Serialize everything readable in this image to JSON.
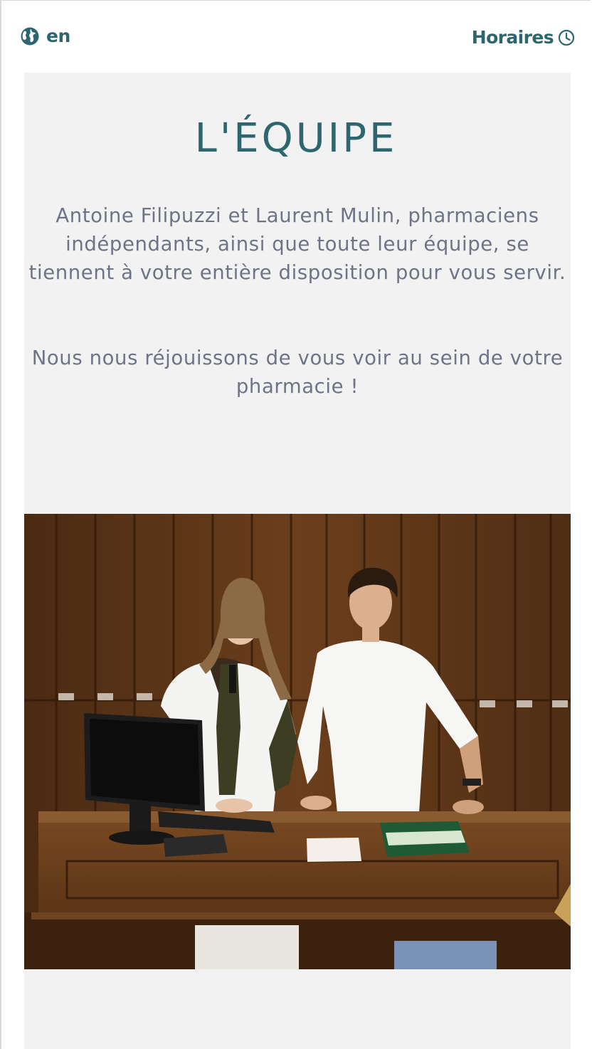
{
  "header": {
    "language_label": "en",
    "hours_label": "Horaires",
    "globe_icon": "globe-icon",
    "clock_icon": "clock-icon"
  },
  "section": {
    "title": "L'ÉQUIPE",
    "paragraph_1": "Antoine Filipuzzi et Laurent Mulin, pharmaciens indépendants, ainsi que toute leur équipe, se tiennent à votre entière disposition pour vous servir.",
    "paragraph_2": "Nous nous réjouissons de vous voir au sein de votre pharmacie !"
  },
  "colors": {
    "accent": "#2e6670",
    "body_text": "#6e7386",
    "panel_background": "#f2f2f2"
  }
}
